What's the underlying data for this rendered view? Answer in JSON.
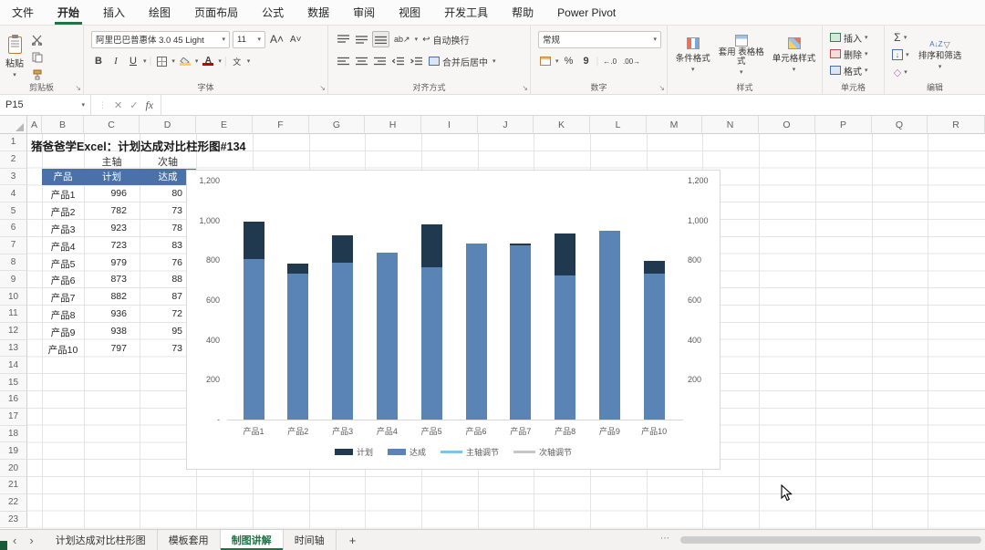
{
  "app_tabs": {
    "items": [
      "文件",
      "开始",
      "插入",
      "绘图",
      "页面布局",
      "公式",
      "数据",
      "审阅",
      "视图",
      "开发工具",
      "帮助",
      "Power Pivot"
    ],
    "active_index": 1
  },
  "ribbon": {
    "clipboard": {
      "paste": "粘贴",
      "label": "剪贴板"
    },
    "font": {
      "name": "阿里巴巴普惠体 3.0 45 Light",
      "size": "11",
      "bold": "B",
      "italic": "I",
      "underline": "U",
      "phonetic": "文",
      "label": "字体"
    },
    "alignment": {
      "wrap": "自动换行",
      "merge": "合并后居中",
      "orientation": "ab↗",
      "label": "对齐方式"
    },
    "number": {
      "format": "常规",
      "percent": "%",
      "comma": "9",
      "inc_dec": "←.0",
      "dec_dec": ".00→",
      "label": "数字"
    },
    "styles": {
      "conditional": "条件格式",
      "table_style": "套用 表格格式",
      "cell_style": "单元格样式",
      "label": "样式"
    },
    "cells": {
      "insert": "插入",
      "delete": "删除",
      "format": "格式",
      "label": "单元格"
    },
    "editing": {
      "sort_filter": "排序和筛选",
      "label": "编辑"
    }
  },
  "formula_bar": {
    "name_box": "P15",
    "value": ""
  },
  "icons": {
    "dropdown": "▾",
    "cancel": "✕",
    "enter": "✓",
    "fx": "fx",
    "sigma": "Σ",
    "fill": "↓",
    "clear": "◇",
    "wrap": "↩",
    "launcher": "↘",
    "prev": "‹",
    "next": "›",
    "add": "+",
    "more": "⋯",
    "sort_az": "A↓Z",
    "funnel": "▽"
  },
  "sheet": {
    "columns": [
      "A",
      "B",
      "C",
      "D",
      "E",
      "F",
      "G",
      "H",
      "I",
      "J",
      "K",
      "L",
      "M",
      "N",
      "O",
      "P",
      "Q",
      "R"
    ],
    "row_count": 23,
    "title_cell": "猪爸爸学Excel：计划达成对比柱形图#134",
    "axis_row": {
      "c": "主轴",
      "d": "次轴"
    },
    "table": {
      "headers": [
        "产品",
        "计划",
        "达成"
      ],
      "rows": [
        {
          "name": "产品1",
          "plan": "996",
          "achieved_visible": "80"
        },
        {
          "name": "产品2",
          "plan": "782",
          "achieved_visible": "73"
        },
        {
          "name": "产品3",
          "plan": "923",
          "achieved_visible": "78"
        },
        {
          "name": "产品4",
          "plan": "723",
          "achieved_visible": "83"
        },
        {
          "name": "产品5",
          "plan": "979",
          "achieved_visible": "76"
        },
        {
          "name": "产品6",
          "plan": "873",
          "achieved_visible": "88"
        },
        {
          "name": "产品7",
          "plan": "882",
          "achieved_visible": "87"
        },
        {
          "name": "产品8",
          "plan": "936",
          "achieved_visible": "72"
        },
        {
          "name": "产品9",
          "plan": "938",
          "achieved_visible": "95"
        },
        {
          "name": "产品10",
          "plan": "797",
          "achieved_visible": "73"
        }
      ]
    }
  },
  "chart_data": {
    "type": "bar",
    "title": "",
    "categories": [
      "产品1",
      "产品2",
      "产品3",
      "产品4",
      "产品5",
      "产品6",
      "产品7",
      "产品8",
      "产品9",
      "产品10"
    ],
    "series": [
      {
        "name": "计划",
        "values": [
          996,
          782,
          923,
          723,
          979,
          873,
          882,
          936,
          938,
          797
        ],
        "color": "#21394f"
      },
      {
        "name": "达成",
        "values": [
          805,
          735,
          790,
          838,
          765,
          885,
          875,
          725,
          950,
          735
        ],
        "color": "#5a83b6"
      },
      {
        "name": "主轴调节",
        "type": "line",
        "values": [],
        "color": "#7cc4e8"
      },
      {
        "name": "次轴调节",
        "type": "line",
        "values": [],
        "color": "#c6c6c6"
      }
    ],
    "bar_overlap": "达成 series drawn in front of 计划 (full overlap)",
    "ylim": [
      0,
      1200
    ],
    "y_ticks_left": [
      "1,200",
      "1,000",
      "800",
      "600",
      "400",
      "200",
      "-"
    ],
    "y_ticks_right": [
      "1,200",
      "1,000",
      "800",
      "600",
      "400",
      "200"
    ],
    "grid": false,
    "legend_position": "bottom"
  },
  "sheet_tabs": {
    "items": [
      "计划达成对比柱形图",
      "模板套用",
      "制图讲解",
      "时间轴"
    ],
    "active_index": 2
  },
  "colors": {
    "excel_green": "#217346",
    "table_header_fill": "#4a72a8",
    "plan_bar": "#21394f",
    "achieved_bar": "#5a83b6",
    "primary_axis_line": "#7cc4e8",
    "secondary_axis_line": "#c6c6c6"
  }
}
